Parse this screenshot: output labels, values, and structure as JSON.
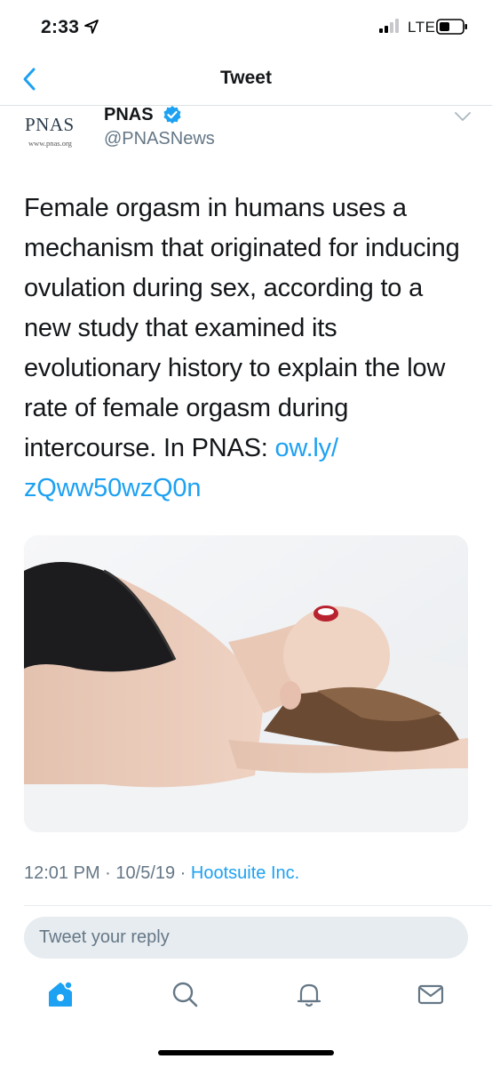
{
  "status_bar": {
    "time": "2:33",
    "network": "LTE",
    "icons": [
      "location-arrow-icon",
      "signal-bars-icon",
      "battery-icon"
    ]
  },
  "nav": {
    "title": "Tweet",
    "back_icon": "chevron-left-icon"
  },
  "tweet": {
    "avatar": {
      "logo_text": "PNAS",
      "logo_url": "www.pnas.org"
    },
    "display_name": "PNAS",
    "verified": true,
    "handle": "@PNASNews",
    "text": "Female orgasm in humans uses a mechanism that originated for inducing ovulation during sex, according to a new study that examined its evolutionary history to explain the low rate of female orgasm during intercourse. In PNAS: ",
    "link": "ow.ly/\nzQww50wzQ0n",
    "time": "12:01 PM",
    "separator_1": " · ",
    "date": "10/5/19",
    "separator_2": " · ",
    "source": "Hootsuite Inc."
  },
  "reply": {
    "placeholder": "Tweet your reply"
  },
  "tab_bar": {
    "tabs": [
      {
        "name": "home",
        "icon": "home-icon",
        "active": true
      },
      {
        "name": "search",
        "icon": "search-icon",
        "active": false
      },
      {
        "name": "notifications",
        "icon": "bell-icon",
        "active": false
      },
      {
        "name": "messages",
        "icon": "mail-icon",
        "active": false
      }
    ]
  },
  "colors": {
    "accent": "#1da1f2",
    "text_primary": "#14171a",
    "text_secondary": "#657786",
    "reply_bg": "#e6ecf0"
  }
}
